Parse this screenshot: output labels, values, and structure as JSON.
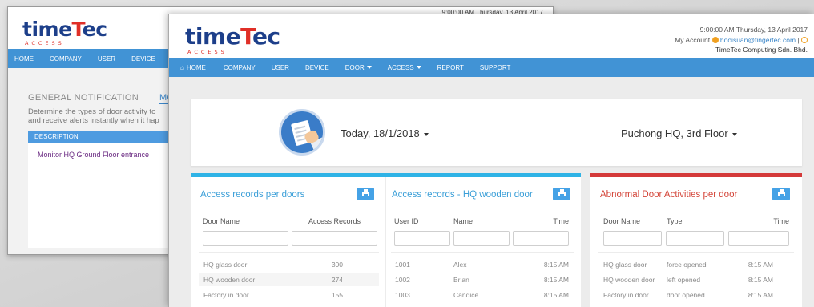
{
  "back_window": {
    "timestamp": "9:00:00 AM Thursday, 13 April 2017",
    "logo": {
      "word_a": "time",
      "word_t": "T",
      "word_b": "ec",
      "sub": "ACCESS"
    },
    "nav": [
      "HOME",
      "COMPANY",
      "USER",
      "DEVICE"
    ],
    "tabs": [
      "GENERAL NOTIFICATION",
      "MONIT"
    ],
    "description_line1": "Determine the types of door activity to",
    "description_line2": "and receive alerts instantly when it hap",
    "table_header": "DESCRIPTION",
    "table_row": "Monitor HQ Ground Floor entrance"
  },
  "front_window": {
    "logo": {
      "word_a": "time",
      "word_t": "T",
      "word_b": "ec",
      "sub": "ACCESS"
    },
    "header": {
      "timestamp": "9:00:00 AM Thursday, 13 April 2017",
      "account_label": "My Account",
      "email": "hooisuan@fingertec.com",
      "separator": "|",
      "company": "TimeTec Computing Sdn. Bhd."
    },
    "nav": {
      "home": "HOME",
      "company": "COMPANY",
      "user": "USER",
      "device": "DEVICE",
      "door": "DOOR",
      "access": "ACCESS",
      "report": "REPORT",
      "support": "SUPPORT"
    },
    "filters": {
      "date": "Today, 18/1/2018",
      "location": "Puchong HQ, 3rd Floor"
    },
    "panel_doors": {
      "title": "Access records per doors",
      "columns": [
        "Door Name",
        "Access Records"
      ],
      "rows": [
        [
          "HQ glass door",
          "300"
        ],
        [
          "HQ wooden door",
          "274"
        ],
        [
          "Factory in door",
          "155"
        ]
      ]
    },
    "panel_wooden": {
      "title": "Access records - HQ wooden door",
      "columns": [
        "User ID",
        "Name",
        "Time"
      ],
      "rows": [
        [
          "1001",
          "Alex",
          "8:15 AM"
        ],
        [
          "1002",
          "Brian",
          "8:15 AM"
        ],
        [
          "1003",
          "Candice",
          "8:15 AM"
        ]
      ]
    },
    "panel_abnormal": {
      "title": "Abnormal Door Activities per door",
      "columns": [
        "Door Name",
        "Type",
        "Time"
      ],
      "rows": [
        [
          "HQ glass door",
          "force opened",
          "8:15 AM"
        ],
        [
          "HQ wooden door",
          "left opened",
          "8:15 AM"
        ],
        [
          "Factory in door",
          "door opened",
          "8:15 AM"
        ]
      ]
    },
    "colors": {
      "nav_blue": "#4193d5",
      "accent_cyan": "#2fb3e6",
      "accent_red": "#d43a3a",
      "link_blue": "#3b86c8",
      "warning_orange": "#f0a020"
    }
  }
}
